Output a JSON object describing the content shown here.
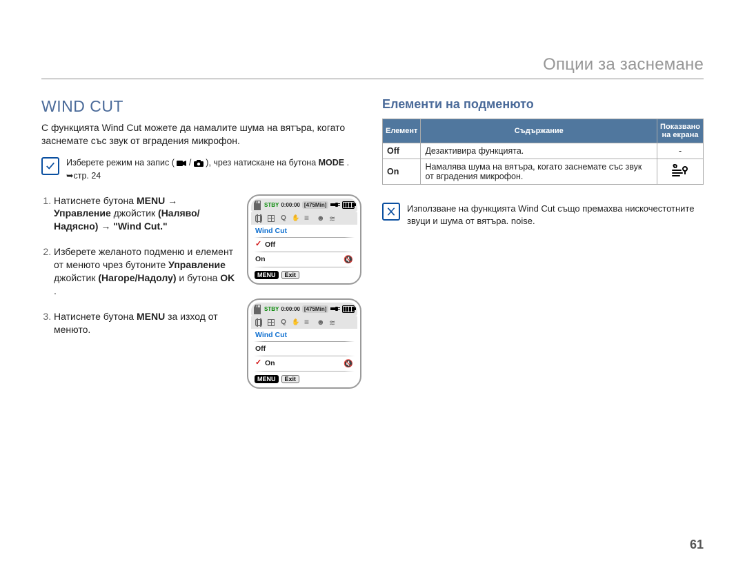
{
  "page": {
    "top_title": "Опции за заснемане",
    "number": "61"
  },
  "wind_cut": {
    "title": "WIND CUT",
    "intro": "С функцията Wind Cut можете да намалите шума на вятъра, когато заснемате със звук от вградения микрофон.",
    "mode_note_prefix": "Изберете режим на запис (",
    "mode_note_suffix": "), чрез натискане на бутона ",
    "mode_note_bold": "MODE",
    "mode_note_page": ". ➥стр. 24",
    "steps": [
      {
        "pre": "Натиснете бутона ",
        "b1": "MENU",
        "arrow1": " → ",
        "b2": "Управление",
        "mid": " джойстик ",
        "b3": "(Наляво/Надясно)",
        "arrow2": " → ",
        "b4": "\"Wind Cut.\""
      },
      {
        "pre": "Изберете желаното подменю и елемент от менюто чрез бутоните ",
        "b1": "Управление",
        "mid": " джойстик ",
        "b2": "(Нагоре/Надолу)",
        "mid2": " и бутона ",
        "b3": "OK",
        "post": "."
      },
      {
        "pre": "Натиснете бутона ",
        "b1": "MENU",
        "post": " за изход от менюто."
      }
    ]
  },
  "lcd": {
    "stby": "STBY",
    "time": "0:00:00",
    "remain": "[475Min]",
    "label": "Wind Cut",
    "off": "Off",
    "on": "On",
    "menu": "MENU",
    "exit": "Exit"
  },
  "submenu": {
    "title": "Елементи на подменюто",
    "th1": "Елемент",
    "th2": "Съдържание",
    "th3_l1": "Показвано",
    "th3_l2": "на екрана",
    "rows": [
      {
        "k": "Off",
        "v": "Дезактивира функцията.",
        "disp": "-"
      },
      {
        "k": "On",
        "v": "Намалява шума на вятъра, когато заснемате със звук от вградения микрофон.",
        "disp": "icon"
      }
    ],
    "info": "Използване на функцията Wind Cut също премахва нискочестотните звуци и шума от вятъра. noise."
  }
}
